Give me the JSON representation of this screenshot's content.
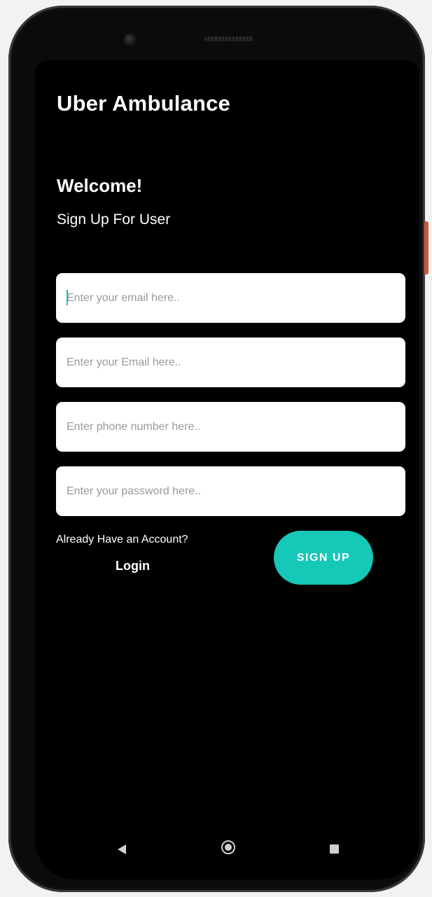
{
  "app": {
    "title": "Uber Ambulance"
  },
  "header": {
    "welcome": "Welcome!",
    "subtitle": "Sign Up For User"
  },
  "form": {
    "fields": [
      {
        "name": "name",
        "value": "",
        "placeholder": "Enter your email here..",
        "focused": true
      },
      {
        "name": "email",
        "value": "",
        "placeholder": "Enter your Email here..",
        "focused": false
      },
      {
        "name": "phone",
        "value": "",
        "placeholder": "Enter phone number here..",
        "focused": false
      },
      {
        "name": "password",
        "value": "",
        "placeholder": "Enter your password here..",
        "focused": false
      }
    ],
    "already_text": "Already Have an Account?",
    "login_label": "Login",
    "signup_label": "SIGN UP"
  },
  "colors": {
    "background": "#000000",
    "accent": "#15c8b8",
    "field_bg": "#ffffff",
    "text": "#ffffff"
  },
  "navbar": {
    "back_icon": "back-triangle-icon",
    "home_icon": "home-circle-icon",
    "recents_icon": "recents-square-icon"
  }
}
